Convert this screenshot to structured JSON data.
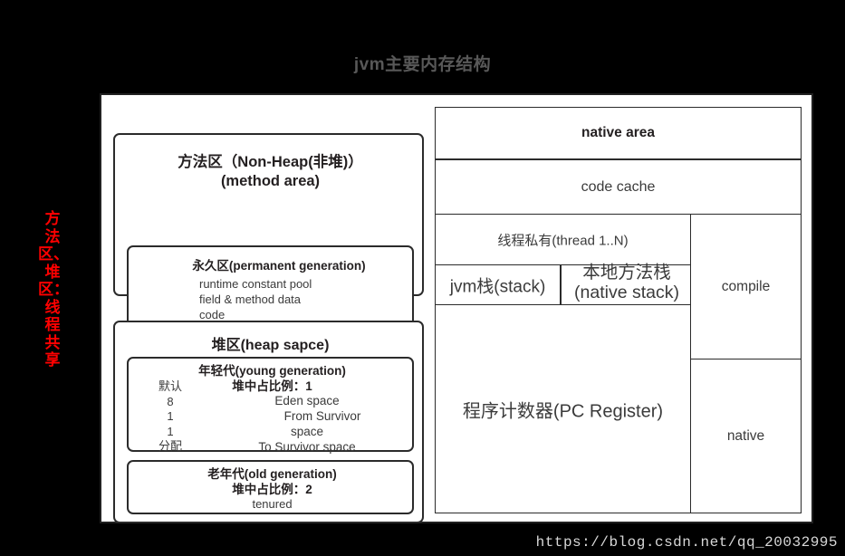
{
  "title": "jvm主要内存结构",
  "sidebar_label": "方法区、堆区：线程共享",
  "left_column": {
    "method_area": {
      "title_line1": "方法区（Non-Heap(非堆)）",
      "title_line2": "(method area)",
      "permanent_generation": {
        "title": "永久区(permanent generation)",
        "items": [
          "runtime constant pool",
          "field & method data",
          "code"
        ]
      }
    },
    "heap": {
      "title": "堆区(heap sapce)",
      "young_generation": {
        "title": "年轻代(young generation)",
        "ratio_label": "堆中占比例：1",
        "ratio_column": [
          "默认",
          "8",
          "1",
          "1",
          "分配"
        ],
        "spaces": [
          "Eden space",
          "From Survivor",
          "space",
          "To Survivor space"
        ]
      },
      "old_generation": {
        "title": "老年代(old generation)",
        "ratio_label": "堆中占比例：2",
        "body": "tenured"
      }
    }
  },
  "right_column": {
    "native_area": "native area",
    "code_cache": "code cache",
    "thread_private": "线程私有(thread 1..N)",
    "jvm_stack": "jvm栈(stack)",
    "native_stack_line1": "本地方法栈",
    "native_stack_line2": "(native stack)",
    "pc_register": "程序计数器(PC Register)",
    "compile": "compile",
    "native": "native"
  },
  "watermark": "https://blog.csdn.net/qq_20032995",
  "colors": {
    "background": "#000000",
    "panel": "#ffffff",
    "border": "#2b2b2b",
    "title_text": "#585858",
    "accent_red": "#ff0000",
    "watermark_text": "#d8d8d8"
  }
}
